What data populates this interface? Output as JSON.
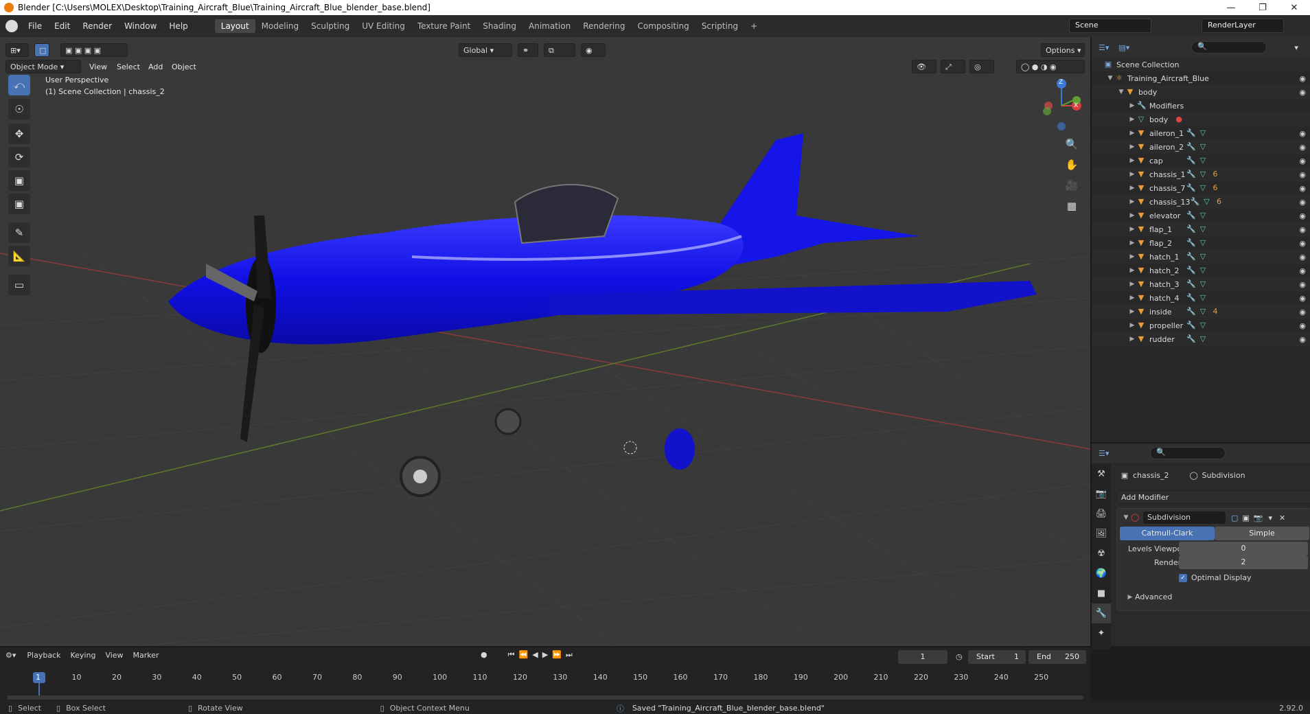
{
  "window": {
    "title": "Blender [C:\\Users\\MOLEX\\Desktop\\Training_Aircraft_Blue\\Training_Aircraft_Blue_blender_base.blend]",
    "min": "—",
    "max": "❐",
    "close": "✕"
  },
  "menu": [
    "File",
    "Edit",
    "Render",
    "Window",
    "Help"
  ],
  "workspaces": [
    "Layout",
    "Modeling",
    "Sculpting",
    "UV Editing",
    "Texture Paint",
    "Shading",
    "Animation",
    "Rendering",
    "Compositing",
    "Scripting",
    "+"
  ],
  "scene_name": "Scene",
  "render_layer": "RenderLayer",
  "viewport": {
    "mode": "Object Mode",
    "header_menus": [
      "View",
      "Select",
      "Add",
      "Object"
    ],
    "transform_orientation": "Global",
    "options_label": "Options",
    "overlay_line1": "User Perspective",
    "overlay_line2": "(1) Scene Collection | chassis_2",
    "gizmo_z": "Z",
    "gizmo_x": "X"
  },
  "outliner": {
    "search_placeholder": "",
    "root": "Scene Collection",
    "collection": "Training_Aircraft_Blue",
    "parent": "body",
    "modifiers_label": "Modifiers",
    "mesh_label": "body",
    "children": [
      "aileron_1",
      "aileron_2",
      "cap",
      "chassis_1",
      "chassis_7",
      "chassis_13",
      "elevator",
      "flap_1",
      "flap_2",
      "hatch_1",
      "hatch_2",
      "hatch_3",
      "hatch_4",
      "inside",
      "propeller",
      "rudder"
    ],
    "badges": {
      "chassis_1": "6",
      "chassis_7": "6",
      "chassis_13": "6",
      "inside": "4"
    }
  },
  "properties": {
    "object_name": "chassis_2",
    "modifier_name": "Subdivision",
    "add_modifier": "Add Modifier",
    "modifier_panel_title": "Subdivision",
    "catmull": "Catmull-Clark",
    "simple": "Simple",
    "levels_viewport_label": "Levels Viewport",
    "levels_viewport_value": "0",
    "render_label": "Render",
    "render_value": "2",
    "optimal_display": "Optimal Display",
    "advanced": "Advanced"
  },
  "timeline": {
    "menus": [
      "Playback",
      "Keying",
      "View",
      "Marker"
    ],
    "current_frame": "1",
    "start_label": "Start",
    "start_value": "1",
    "end_label": "End",
    "end_value": "250",
    "ticks": [
      "1",
      "10",
      "20",
      "30",
      "40",
      "50",
      "60",
      "70",
      "80",
      "90",
      "100",
      "110",
      "120",
      "130",
      "140",
      "150",
      "160",
      "170",
      "180",
      "190",
      "200",
      "210",
      "220",
      "230",
      "240",
      "250"
    ]
  },
  "status": {
    "select": "Select",
    "box_select": "Box Select",
    "rotate_view": "Rotate View",
    "context_menu": "Object Context Menu",
    "message": "Saved \"Training_Aircraft_Blue_blender_base.blend\"",
    "version": "2.92.0"
  }
}
